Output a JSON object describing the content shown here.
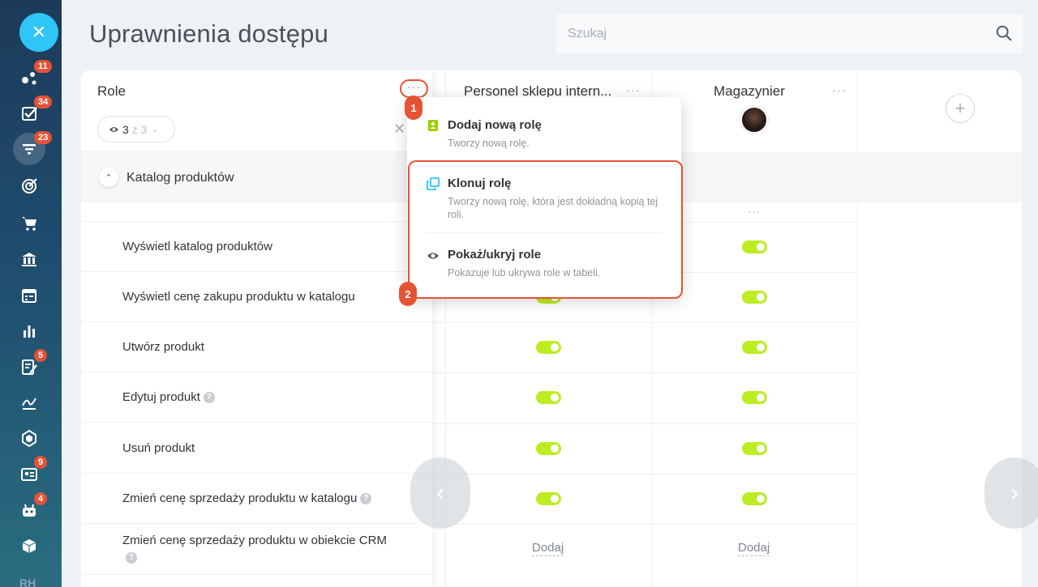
{
  "header": {
    "title": "Uprawnienia dostępu",
    "search_placeholder": "Szukaj"
  },
  "leftbar": {
    "close_glyph": "✕",
    "items": [
      {
        "icon": "activity-stream-icon",
        "badge": "11"
      },
      {
        "icon": "tasks-icon",
        "badge": "34"
      },
      {
        "icon": "crm-funnel-icon",
        "badge": "23",
        "active": true
      },
      {
        "icon": "target-icon",
        "badge": ""
      },
      {
        "icon": "cart-icon",
        "badge": ""
      },
      {
        "icon": "bank-icon",
        "badge": ""
      },
      {
        "icon": "calendar-icon",
        "badge": ""
      },
      {
        "icon": "analytics-icon",
        "badge": ""
      },
      {
        "icon": "documents-icon",
        "badge": "5"
      },
      {
        "icon": "signature-icon",
        "badge": ""
      },
      {
        "icon": "hexagon-icon",
        "badge": ""
      },
      {
        "icon": "contact-card-icon",
        "badge": "9"
      },
      {
        "icon": "robot-icon",
        "badge": "4"
      },
      {
        "icon": "box-icon",
        "badge": ""
      }
    ],
    "bottom_text": "RH"
  },
  "roles_panel": {
    "label": "Role",
    "more": "···",
    "filter": {
      "count": "3",
      "of": "z 3"
    },
    "clear": "✕"
  },
  "section": {
    "label": "Katalog produktów"
  },
  "permissions": [
    {
      "label": "Wyświetl katalog produktów",
      "help": false
    },
    {
      "label": "Wyświetl cenę zakupu produktu w katalogu",
      "help": false
    },
    {
      "label": "Utwórz produkt",
      "help": false
    },
    {
      "label": "Edytuj produkt",
      "help": true
    },
    {
      "label": "Usuń produkt",
      "help": false
    },
    {
      "label": "Zmień cenę sprzedaży produktu w katalogu",
      "help": true
    },
    {
      "label": "Zmień cenę sprzedaży produktu w obiekcie CRM",
      "help": true
    }
  ],
  "columns": [
    {
      "title": "Personel sklepu intern...",
      "more": "···"
    },
    {
      "title": "Magazynier",
      "more": "···"
    }
  ],
  "add_role_glyph": "+",
  "cell_add_label": "Dodaj",
  "help_glyph": "?",
  "toggle_state": "on",
  "dropdown": {
    "items": [
      {
        "title": "Dodaj nową rolę",
        "desc": "Tworzy nową rolę."
      },
      {
        "title": "Klonuj rolę",
        "desc": "Tworzy nową rolę, która jest dokładną kopią tej roli."
      },
      {
        "title": "Pokaż/ukryj role",
        "desc": "Pokazuje lub ukrywa role w tabeli."
      }
    ]
  },
  "annotations": {
    "step1": "1",
    "step2": "2"
  },
  "colors": {
    "accent": "#2fc6f6",
    "toggle_on": "#bbed21",
    "highlight": "#e65235"
  }
}
